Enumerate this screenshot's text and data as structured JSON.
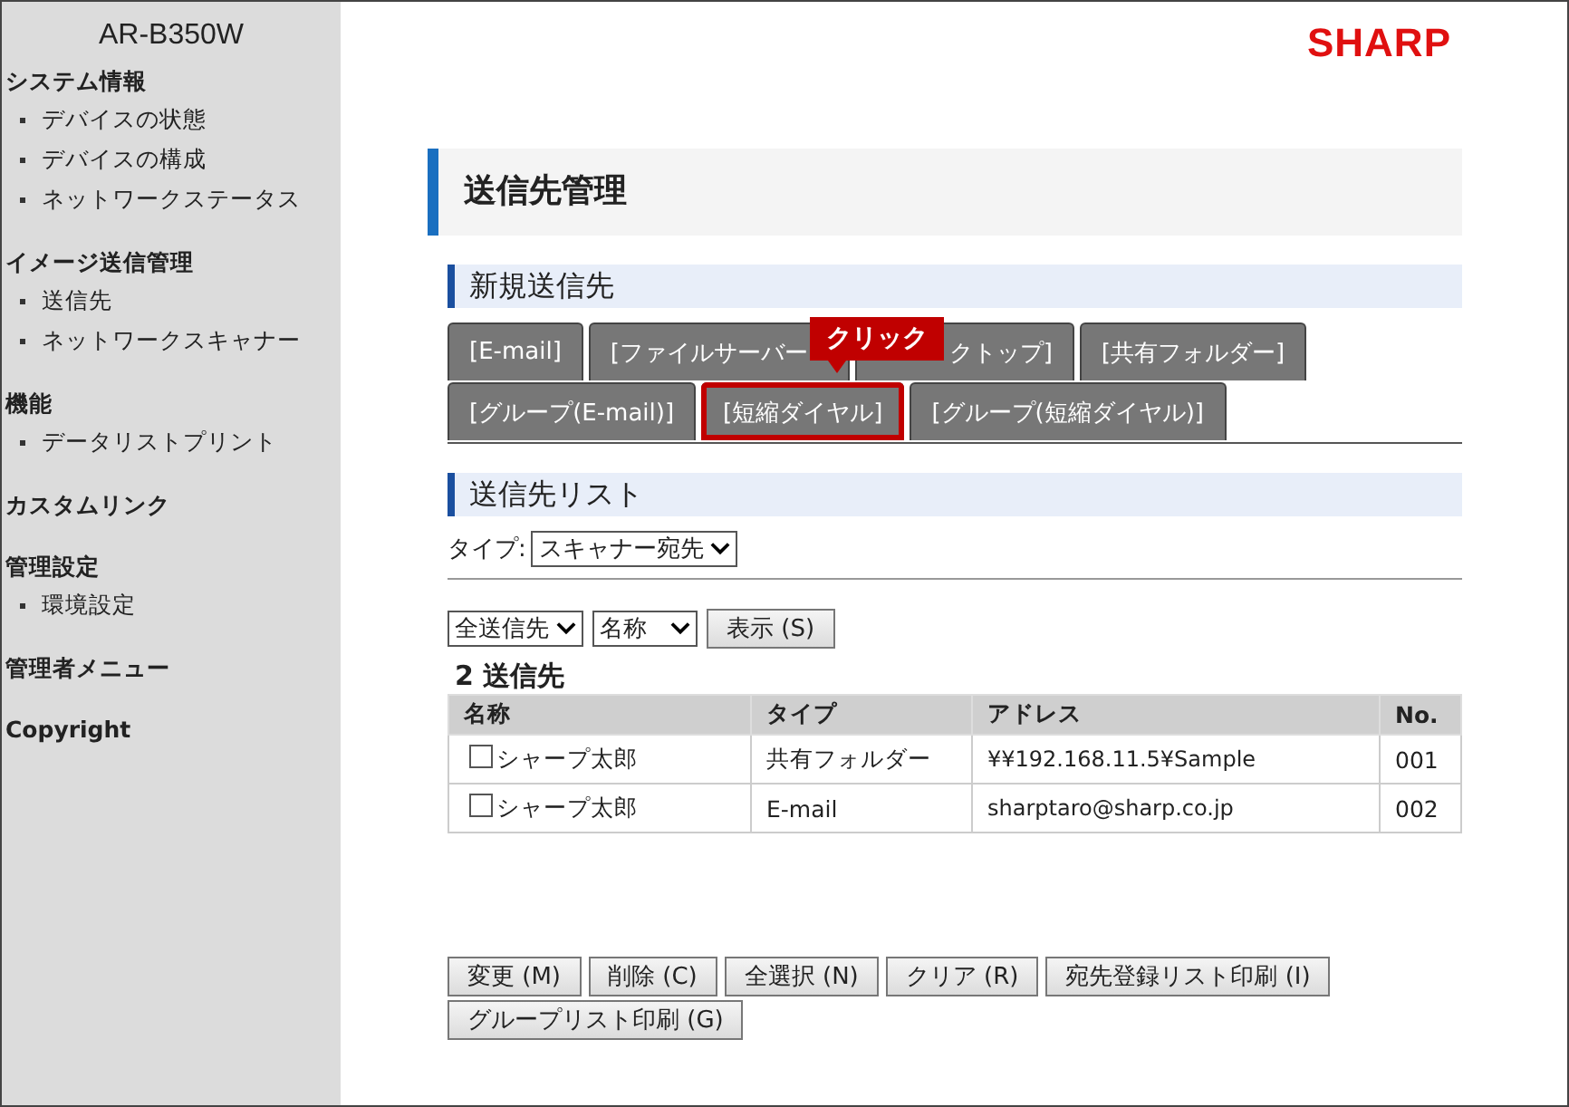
{
  "sidebar": {
    "model": "AR-B350W",
    "sections": [
      {
        "title": "システム情報",
        "items": [
          "デバイスの状態",
          "デバイスの構成",
          "ネットワークステータス"
        ]
      },
      {
        "title": "イメージ送信管理",
        "items": [
          "送信先",
          "ネットワークスキャナー"
        ]
      },
      {
        "title": "機能",
        "items": [
          "データリストプリント"
        ]
      },
      {
        "title": "カスタムリンク"
      },
      {
        "title": "管理設定",
        "items": [
          "環境設定"
        ]
      },
      {
        "title": "管理者メニュー"
      },
      {
        "title": "Copyright"
      }
    ]
  },
  "logo": "SHARP",
  "page_title": "送信先管理",
  "new_section": {
    "title": "新規送信先",
    "tab_rows": [
      [
        {
          "kind": "whole",
          "label": "[E-mail]",
          "highlighted": false
        },
        {
          "kind": "cut-end",
          "label": "[ファイルサーバー",
          "highlighted": false
        },
        {
          "kind": "cut-start",
          "label": "クトップ]",
          "highlighted": false
        },
        {
          "kind": "whole",
          "label": "[共有フォルダー]",
          "highlighted": false
        }
      ],
      [
        {
          "kind": "whole",
          "label": "[グループ(E-mail)]",
          "highlighted": false
        },
        {
          "kind": "whole",
          "label": "[短縮ダイヤル]",
          "highlighted": true
        },
        {
          "kind": "whole",
          "label": "[グループ(短縮ダイヤル)]",
          "highlighted": false
        }
      ]
    ],
    "callout": "クリック"
  },
  "list_section": {
    "title": "送信先リスト",
    "type_label": "タイプ:",
    "type_value": "スキャナー宛先",
    "filter1": "全送信先",
    "filter2": "名称",
    "show_button": "表示 (S)",
    "count": "2 送信先",
    "columns": [
      "名称",
      "タイプ",
      "アドレス",
      "No."
    ],
    "rows": [
      {
        "checked": false,
        "name": "シャープ太郎",
        "type": "共有フォルダー",
        "address": "¥¥192.168.11.5¥Sample",
        "no": "001"
      },
      {
        "checked": false,
        "name": "シャープ太郎",
        "type": "E-mail",
        "address": "sharptaro@sharp.co.jp",
        "no": "002"
      }
    ]
  },
  "buttons": [
    "変更 (M)",
    "削除 (C)",
    "全選択 (N)",
    "クリア (R)",
    "宛先登録リスト印刷 (I)",
    "グループリスト印刷 (G)"
  ]
}
